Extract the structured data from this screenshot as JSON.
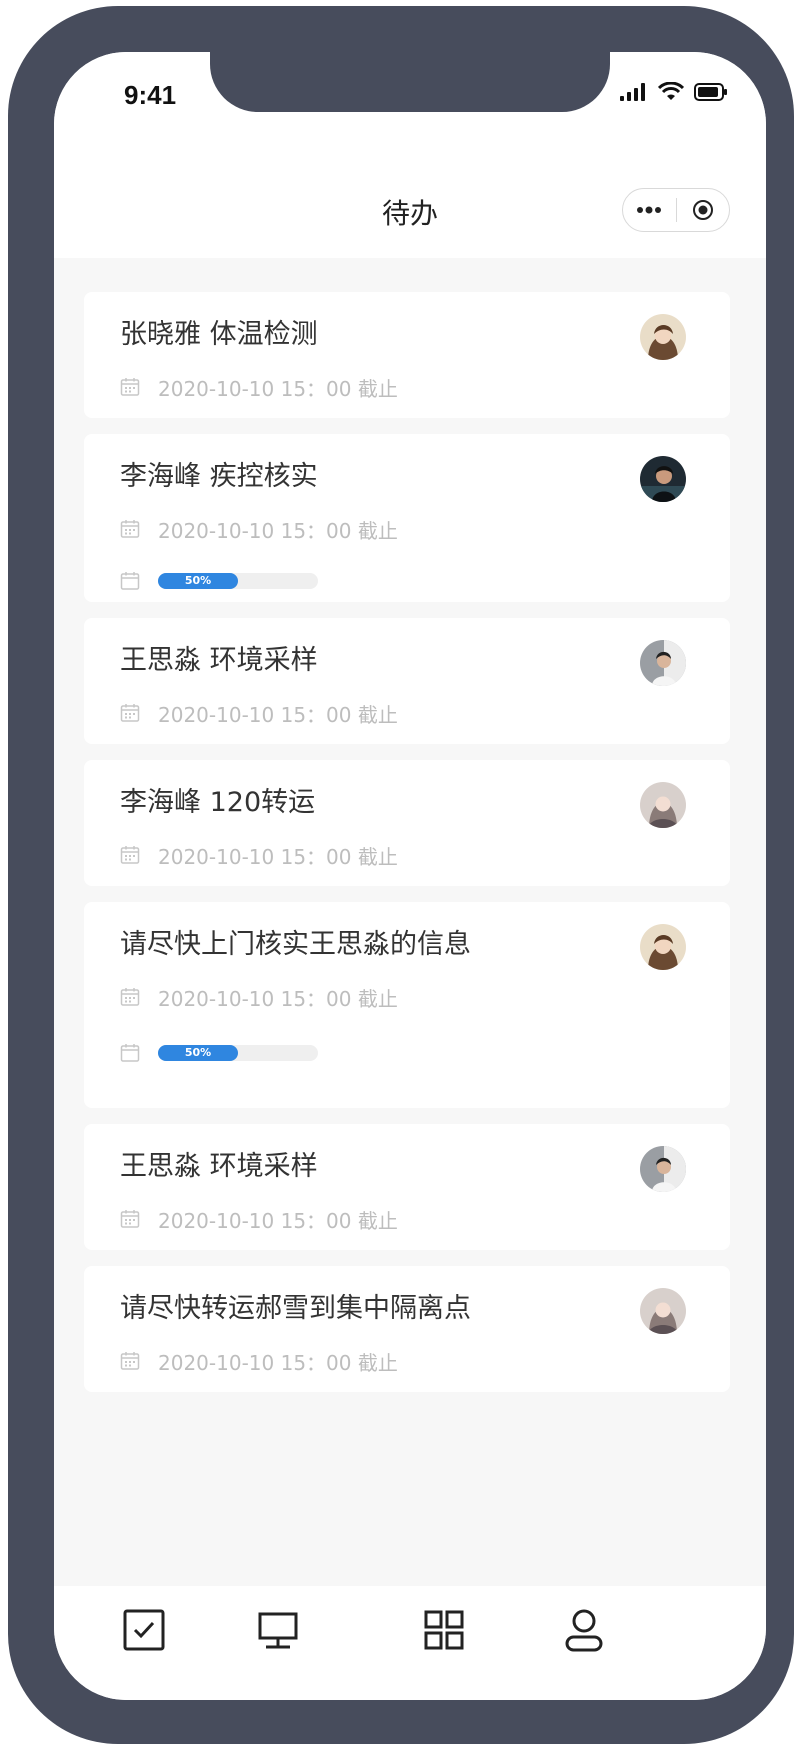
{
  "status_bar": {
    "time": "9:41",
    "icons": [
      "signal-icon",
      "wifi-icon",
      "battery-icon"
    ]
  },
  "nav": {
    "title": "待办",
    "capsule": [
      "more-dots-icon",
      "close-target-icon"
    ]
  },
  "colors": {
    "frame": "#474c5c",
    "background": "#f7f7f7",
    "progress_fill": "#2f86e0",
    "muted_text": "#bdbdbd"
  },
  "tasks": [
    {
      "title": "张晓雅  体温检测",
      "deadline": "2020-10-10 15：00 截止",
      "avatar": "avatar-woman-brown-hair"
    },
    {
      "title": "李海峰  疾控核实",
      "deadline": "2020-10-10 15：00 截止",
      "progress_label": "50%",
      "progress": 0.5,
      "avatar": "avatar-man-dark"
    },
    {
      "title": "王思淼   环境采样",
      "deadline": "2020-10-10 15：00 截止",
      "avatar": "avatar-man-grey"
    },
    {
      "title": "李海峰  120转运",
      "deadline": "2020-10-10 15：00 截止",
      "avatar": "avatar-woman-scarf"
    },
    {
      "title": "请尽快上门核实王思淼的信息",
      "deadline": "2020-10-10 15：00 截止",
      "progress_label": "50%",
      "progress": 0.5,
      "avatar": "avatar-woman-brown-hair"
    },
    {
      "title": "王思淼   环境采样",
      "deadline": "2020-10-10 15：00 截止",
      "avatar": "avatar-man-grey"
    },
    {
      "title": "请尽快转运郝雪到集中隔离点",
      "deadline": "2020-10-10 15：00 截止",
      "avatar": "avatar-woman-scarf"
    }
  ],
  "tabbar": [
    "todo-check-icon",
    "computer-icon",
    "grid-apps-icon",
    "user-profile-icon"
  ]
}
